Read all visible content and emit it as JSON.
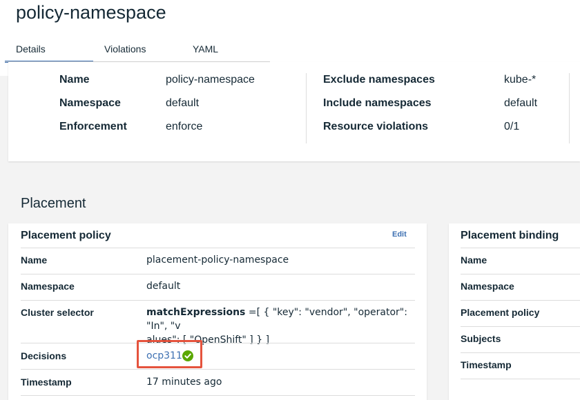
{
  "page": {
    "title": "policy-namespace",
    "tabs": [
      {
        "label": "Details",
        "active": true
      },
      {
        "label": "Violations",
        "active": false
      },
      {
        "label": "YAML",
        "active": false
      }
    ]
  },
  "details": {
    "left": [
      {
        "label": "Name",
        "value": "policy-namespace"
      },
      {
        "label": "Namespace",
        "value": "default"
      },
      {
        "label": "Enforcement",
        "value": "enforce"
      }
    ],
    "right": [
      {
        "label": "Exclude namespaces",
        "value": "kube-*"
      },
      {
        "label": "Include namespaces",
        "value": "default"
      },
      {
        "label": "Resource violations",
        "value": "0/1"
      }
    ]
  },
  "placement": {
    "section_title": "Placement",
    "policy_card": {
      "title": "Placement policy",
      "edit_label": "Edit",
      "rows": {
        "name": {
          "label": "Name",
          "value": "placement-policy-namespace"
        },
        "namespace": {
          "label": "Namespace",
          "value": "default"
        },
        "cluster_selector": {
          "label": "Cluster selector",
          "key": "matchExpressions",
          "value_line1": " =[ { \"key\": \"vendor\", \"operator\": \"In\", \"v",
          "value_line2": "alues\": [ \"OpenShift\" ] } ]"
        },
        "decisions": {
          "label": "Decisions",
          "cluster": "ocp311",
          "status_color": "#5aa700"
        },
        "timestamp": {
          "label": "Timestamp",
          "value": "17 minutes ago"
        }
      }
    },
    "binding_card": {
      "title": "Placement binding",
      "labels": [
        "Name",
        "Namespace",
        "Placement policy",
        "Subjects",
        "Timestamp"
      ]
    }
  },
  "colors": {
    "accent": "#3d70b2",
    "highlight_border": "#e5533d",
    "success": "#5aa700"
  }
}
